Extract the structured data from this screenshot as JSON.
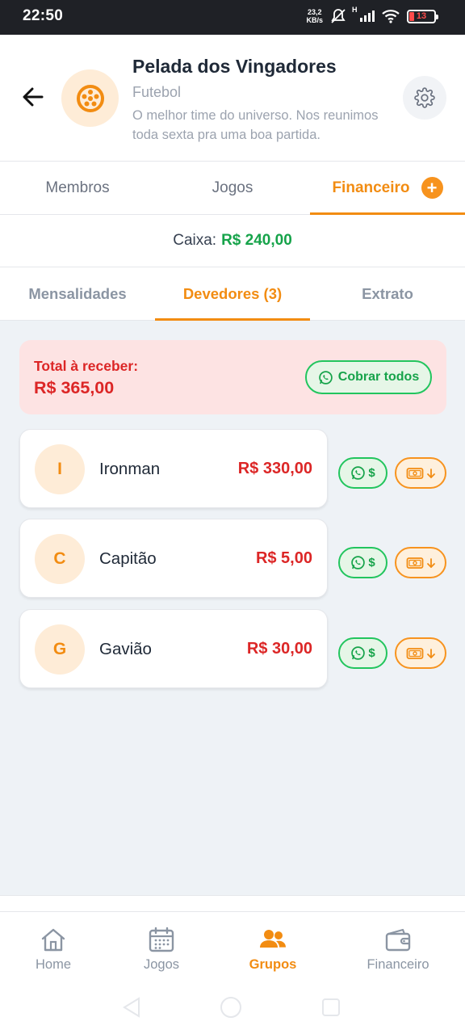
{
  "status_bar": {
    "time": "22:50",
    "net_speed_value": "23,2",
    "net_speed_unit": "KB/s",
    "signal_type": "H",
    "battery": "13"
  },
  "header": {
    "group_name": "Pelada dos Vingadores",
    "sport": "Futebol",
    "description": "O melhor time do universo. Nos reunimos toda sexta pra uma boa partida."
  },
  "main_tabs": [
    {
      "label": "Membros"
    },
    {
      "label": "Jogos"
    },
    {
      "label": "Financeiro"
    }
  ],
  "caixa": {
    "label": "Caixa:",
    "amount": "R$ 240,00"
  },
  "sub_tabs": [
    {
      "label": "Mensalidades"
    },
    {
      "label": "Devedores (3)"
    },
    {
      "label": "Extrato"
    }
  ],
  "total": {
    "label": "Total à receber:",
    "value": "R$ 365,00",
    "cobrar_label": "Cobrar todos"
  },
  "debtors": [
    {
      "initial": "I",
      "name": "Ironman",
      "amount": "R$ 330,00"
    },
    {
      "initial": "C",
      "name": "Capitão",
      "amount": "R$ 5,00"
    },
    {
      "initial": "G",
      "name": "Gavião",
      "amount": "R$ 30,00"
    }
  ],
  "action_labels": {
    "whatsapp_symbol": "$"
  },
  "bottom_nav": [
    {
      "label": "Home",
      "icon": "home-icon"
    },
    {
      "label": "Jogos",
      "icon": "calendar-icon"
    },
    {
      "label": "Grupos",
      "icon": "group-icon"
    },
    {
      "label": "Financeiro",
      "icon": "wallet-icon"
    }
  ],
  "colors": {
    "accent": "#f28c12",
    "success": "#16a34a",
    "danger": "#dc2626"
  }
}
